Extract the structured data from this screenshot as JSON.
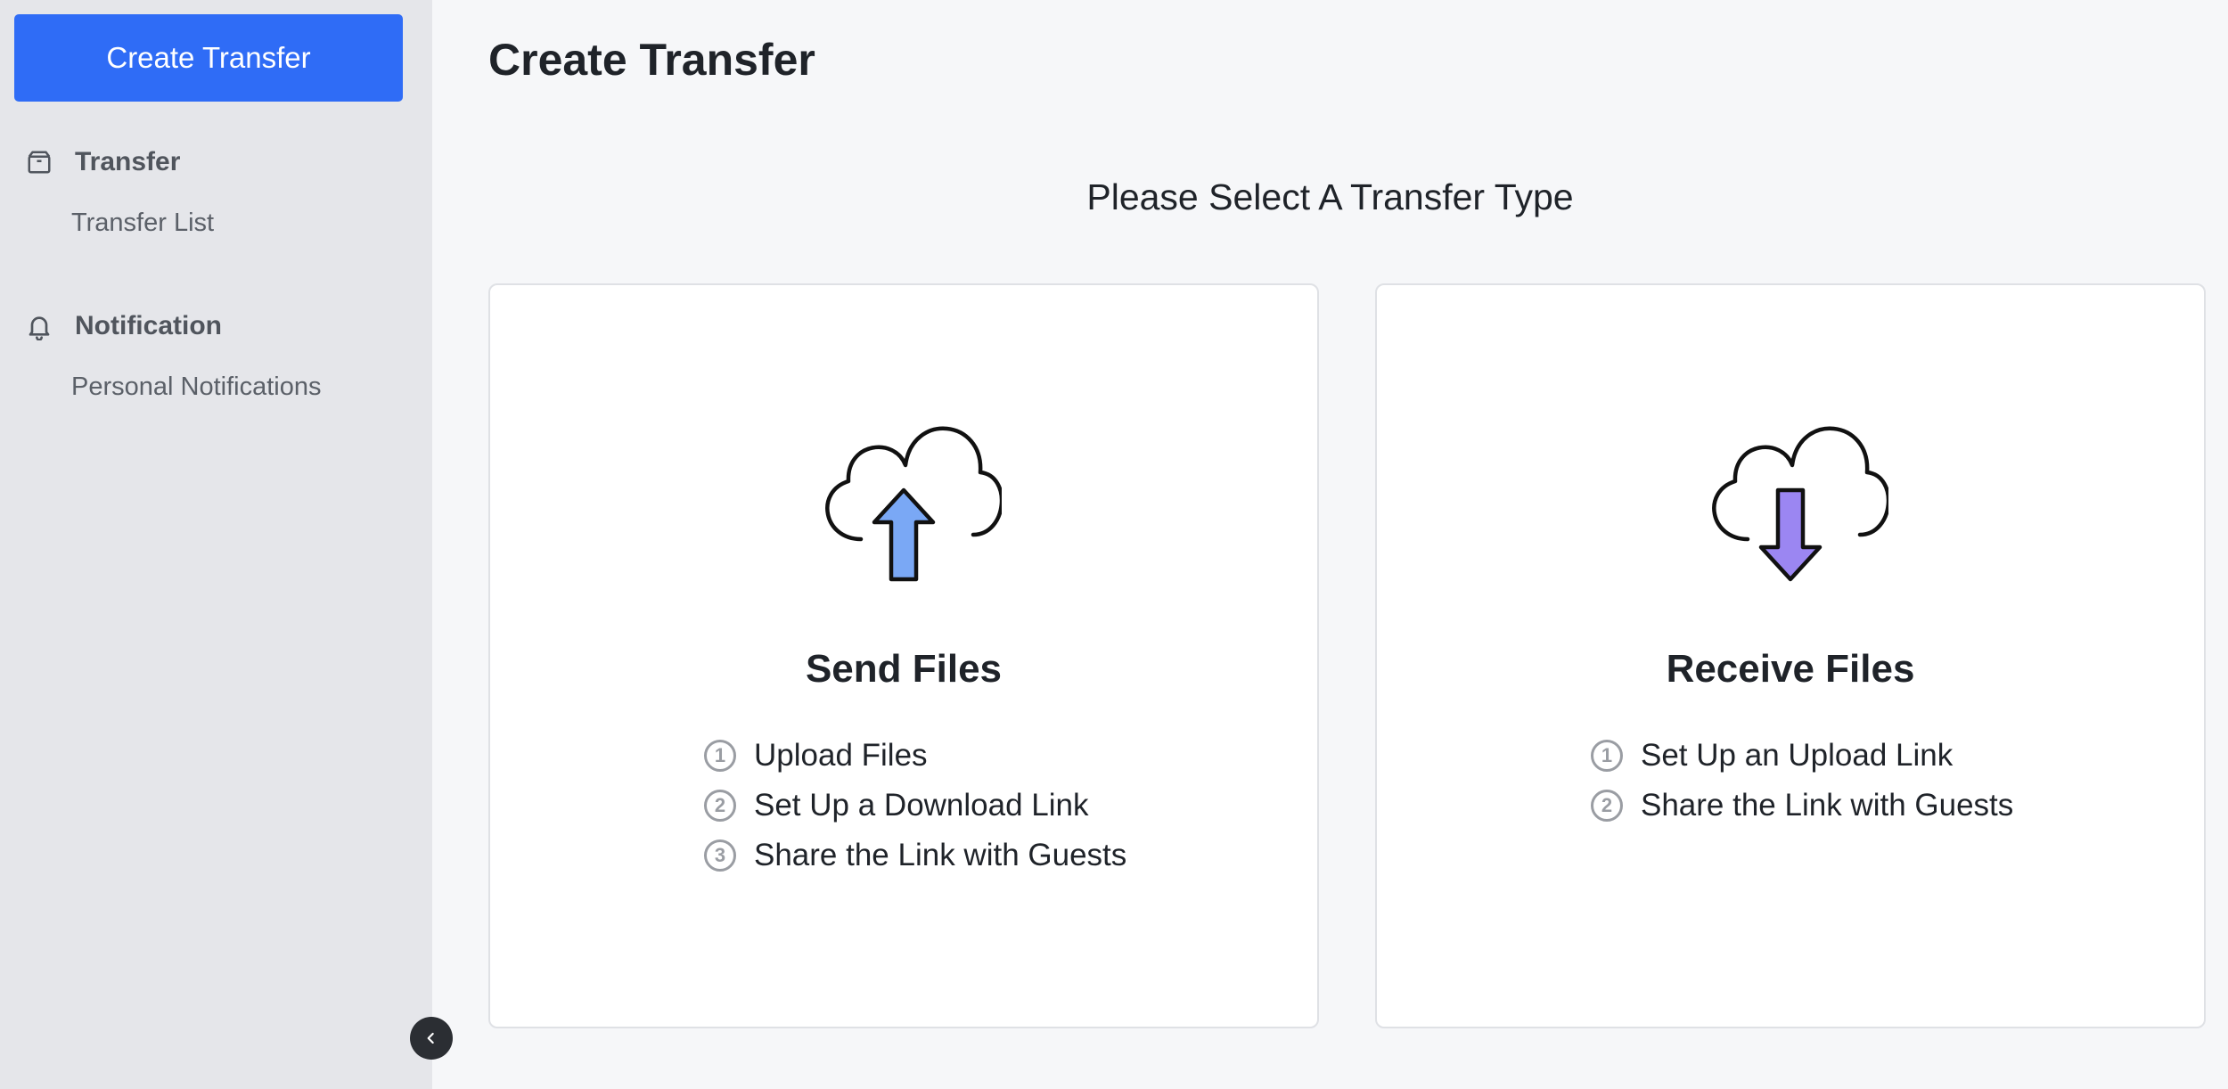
{
  "sidebar": {
    "create_button": "Create Transfer",
    "groups": [
      {
        "label": "Transfer",
        "icon": "package-icon",
        "items": [
          {
            "label": "Transfer List"
          }
        ]
      },
      {
        "label": "Notification",
        "icon": "bell-icon",
        "items": [
          {
            "label": "Personal Notifications"
          }
        ]
      }
    ],
    "collapse_icon": "chevron-left-icon"
  },
  "main": {
    "title": "Create Transfer",
    "subtitle": "Please Select A Transfer Type",
    "cards": [
      {
        "title": "Send Files",
        "icon": "cloud-upload-icon",
        "accent": "#7aa8f5",
        "steps": [
          {
            "num": "1",
            "text": "Upload Files"
          },
          {
            "num": "2",
            "text": "Set Up a Download Link"
          },
          {
            "num": "3",
            "text": "Share the Link with Guests"
          }
        ]
      },
      {
        "title": "Receive Files",
        "icon": "cloud-download-icon",
        "accent": "#9b86f2",
        "steps": [
          {
            "num": "1",
            "text": "Set Up an Upload Link"
          },
          {
            "num": "2",
            "text": "Share the Link with Guests"
          }
        ]
      }
    ]
  },
  "colors": {
    "primary": "#2f6cf6",
    "sidebar_bg": "#e5e6ea",
    "page_bg": "#f6f7f9"
  }
}
